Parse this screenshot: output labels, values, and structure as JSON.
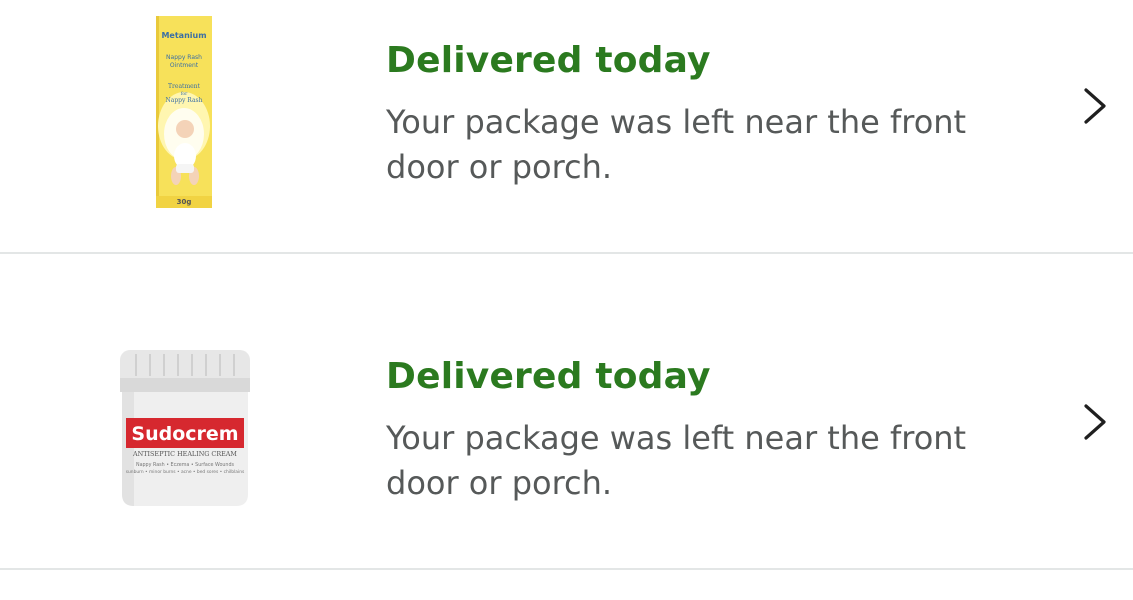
{
  "orders": [
    {
      "status": "Delivered today",
      "detail": "Your package was left near the front door or porch.",
      "product_icon": "metanium-ointment-product-image",
      "product_text": {
        "brand": "Metanium",
        "name_line1": "Nappy Rash",
        "name_line2": "Ointment",
        "treatment_line1": "Treatment",
        "treatment_line2": "for",
        "treatment_line3": "Nappy Rash",
        "weight": "30g"
      }
    },
    {
      "status": "Delivered today",
      "detail": "Your package was left near the front door or porch.",
      "product_icon": "sudocrem-tub-product-image",
      "product_text": {
        "brand": "Sudocrem",
        "subtitle": "ANTISEPTIC HEALING CREAM",
        "uses_line1": "Nappy Rash • Eczema • Surface Wounds",
        "uses_line2": "sunburn • minor burns • acne • bed sores • chilblains"
      }
    }
  ],
  "colors": {
    "status_green": "#2b7a1f",
    "detail_gray": "#565959",
    "divider": "#e3e6e6",
    "metanium_yellow": "#f7e15a",
    "sudocrem_red": "#d6282f"
  },
  "chevron_icon": "chevron-right-icon"
}
